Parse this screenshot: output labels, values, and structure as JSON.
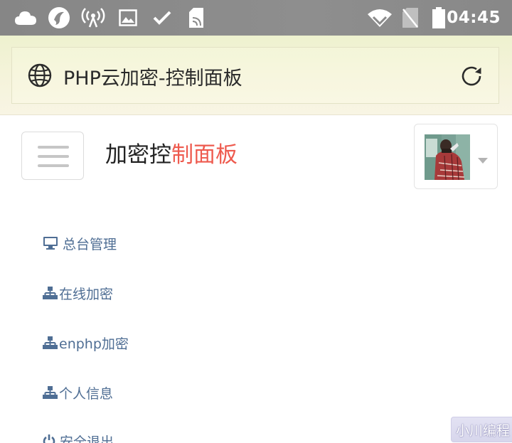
{
  "status_bar": {
    "time": "04:45",
    "left_icons": [
      "cloud-icon",
      "qq-browser-icon",
      "wifi-hotspot-icon",
      "image-icon",
      "check-icon",
      "sd-card-icon"
    ],
    "right_icons": [
      "wifi-icon",
      "no-sim-icon",
      "battery-icon"
    ]
  },
  "browser": {
    "title": "PHP云加密-控制面板"
  },
  "header": {
    "brand_part1": "加密控",
    "brand_part2": "制面板",
    "brand_accent_color": "#ee5a4e"
  },
  "menu": {
    "items": [
      {
        "label": "总台管理",
        "icon": "desktop-icon"
      },
      {
        "label": "在线加密",
        "icon": "sitemap-icon"
      },
      {
        "label": "enphp加密",
        "icon": "sitemap-icon"
      },
      {
        "label": "个人信息",
        "icon": "sitemap-icon"
      },
      {
        "label": "安全退出",
        "icon": "power-icon"
      }
    ],
    "link_color": "#4f6e94"
  },
  "watermark": {
    "text": "小川编程"
  }
}
